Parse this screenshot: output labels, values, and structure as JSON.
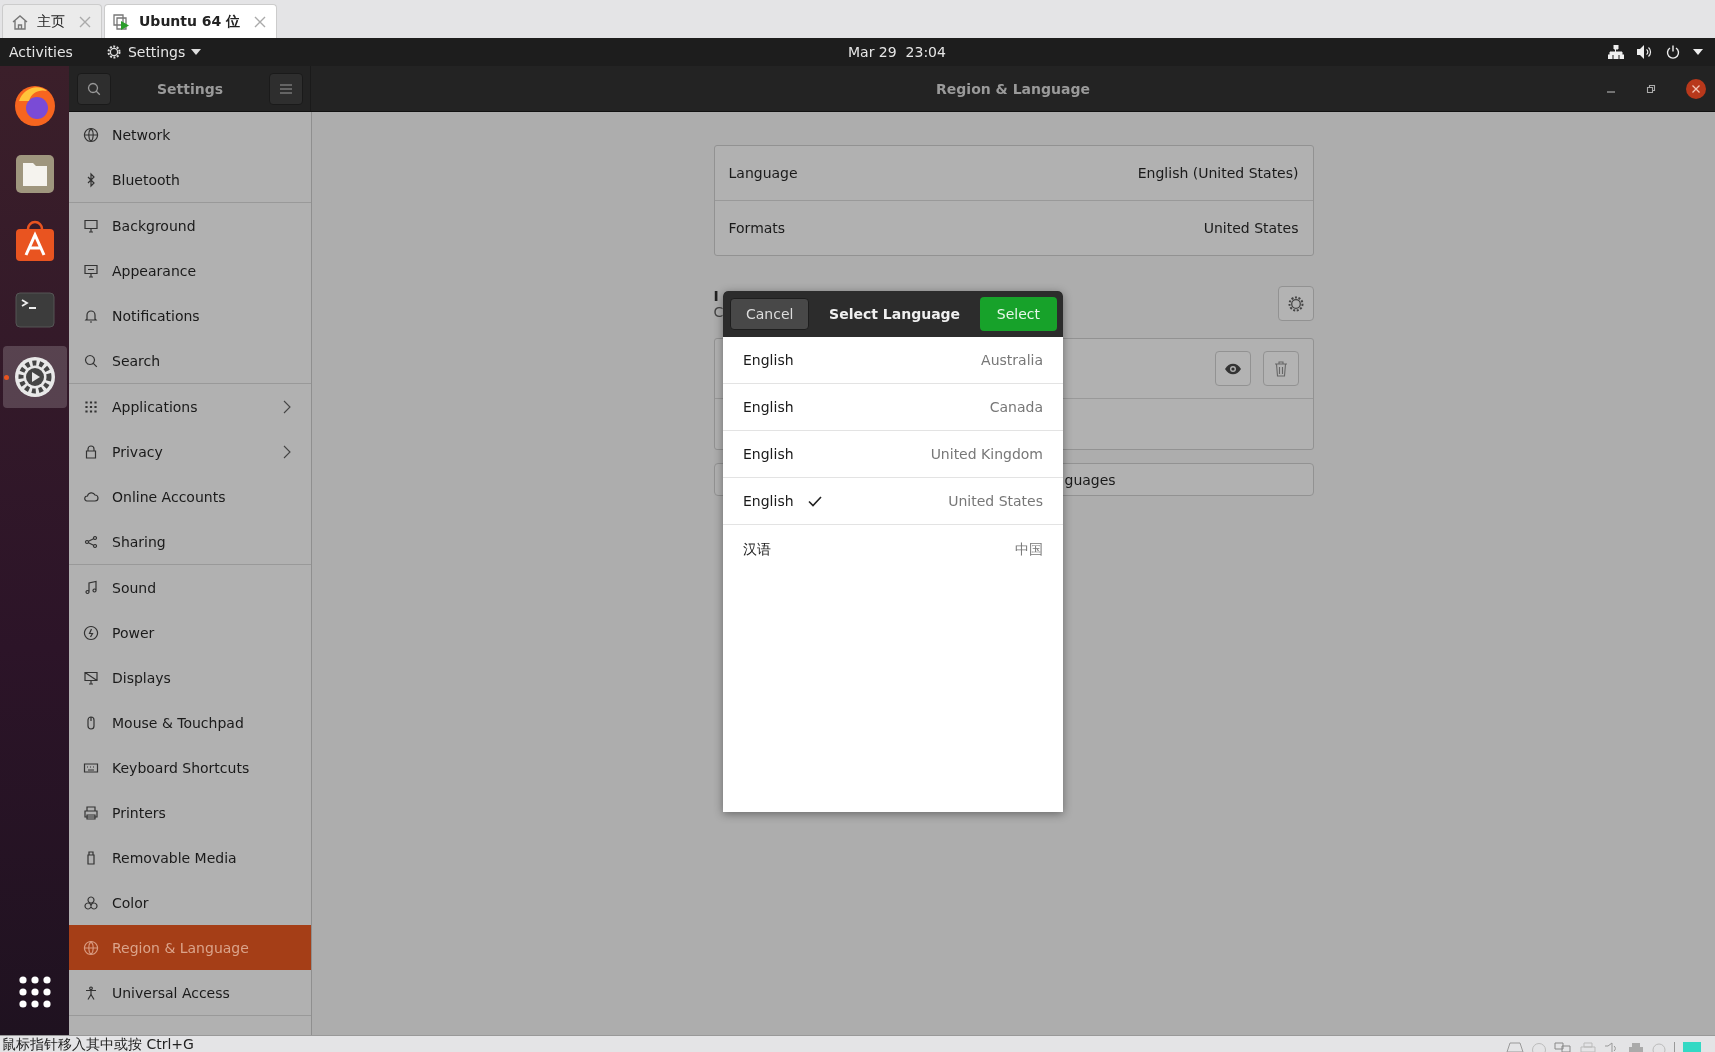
{
  "browser_tabs": [
    {
      "label": "主页",
      "selected": false
    },
    {
      "label": "Ubuntu 64 位",
      "selected": true
    }
  ],
  "top_bar": {
    "activities": "Activities",
    "app_menu": "Settings",
    "clock": "Mar 29  23:04"
  },
  "dock": [
    {
      "selected": false,
      "running": false
    },
    {
      "selected": false,
      "running": false
    },
    {
      "selected": false,
      "running": false
    },
    {
      "selected": false,
      "running": false
    },
    {
      "selected": true,
      "running": true
    }
  ],
  "sidebar": {
    "title": "Settings",
    "groups": [
      [
        {
          "label": "Network",
          "has_submenu": false,
          "selected": false
        },
        {
          "label": "Bluetooth",
          "has_submenu": false,
          "selected": false
        }
      ],
      [
        {
          "label": "Background",
          "has_submenu": false,
          "selected": false
        },
        {
          "label": "Appearance",
          "has_submenu": false,
          "selected": false
        },
        {
          "label": "Notifications",
          "has_submenu": false,
          "selected": false
        },
        {
          "label": "Search",
          "has_submenu": false,
          "selected": false
        }
      ],
      [
        {
          "label": "Applications",
          "has_submenu": true,
          "selected": false
        },
        {
          "label": "Privacy",
          "has_submenu": true,
          "selected": false
        },
        {
          "label": "Online Accounts",
          "has_submenu": false,
          "selected": false
        },
        {
          "label": "Sharing",
          "has_submenu": false,
          "selected": false
        }
      ],
      [
        {
          "label": "Sound",
          "has_submenu": false,
          "selected": false
        },
        {
          "label": "Power",
          "has_submenu": false,
          "selected": false
        },
        {
          "label": "Displays",
          "has_submenu": false,
          "selected": false
        },
        {
          "label": "Mouse & Touchpad",
          "has_submenu": false,
          "selected": false
        },
        {
          "label": "Keyboard Shortcuts",
          "has_submenu": false,
          "selected": false
        },
        {
          "label": "Printers",
          "has_submenu": false,
          "selected": false
        },
        {
          "label": "Removable Media",
          "has_submenu": false,
          "selected": false
        },
        {
          "label": "Color",
          "has_submenu": false,
          "selected": false
        },
        {
          "label": "Region & Language",
          "has_submenu": false,
          "selected": true
        },
        {
          "label": "Universal Access",
          "has_submenu": false,
          "selected": false
        }
      ]
    ]
  },
  "window": {
    "title": "Region & Language"
  },
  "language_panel": {
    "rows": [
      {
        "label": "Language",
        "value": "English (United States)"
      },
      {
        "label": "Formats",
        "value": "United States"
      }
    ]
  },
  "input_sources": {
    "heading": "I",
    "subtitle": "C",
    "manage_button": "guages"
  },
  "dialog": {
    "cancel": "Cancel",
    "title": "Select Language",
    "select": "Select",
    "languages": [
      {
        "name": "English",
        "region": "Australia",
        "selected": false
      },
      {
        "name": "English",
        "region": "Canada",
        "selected": false
      },
      {
        "name": "English",
        "region": "United Kingdom",
        "selected": false
      },
      {
        "name": "English",
        "region": "United States",
        "selected": true
      },
      {
        "name": "汉语",
        "region": "中国",
        "selected": false
      }
    ]
  },
  "status_bar": {
    "hint": "鼠标指针移入其中或按 Ctrl+G"
  }
}
